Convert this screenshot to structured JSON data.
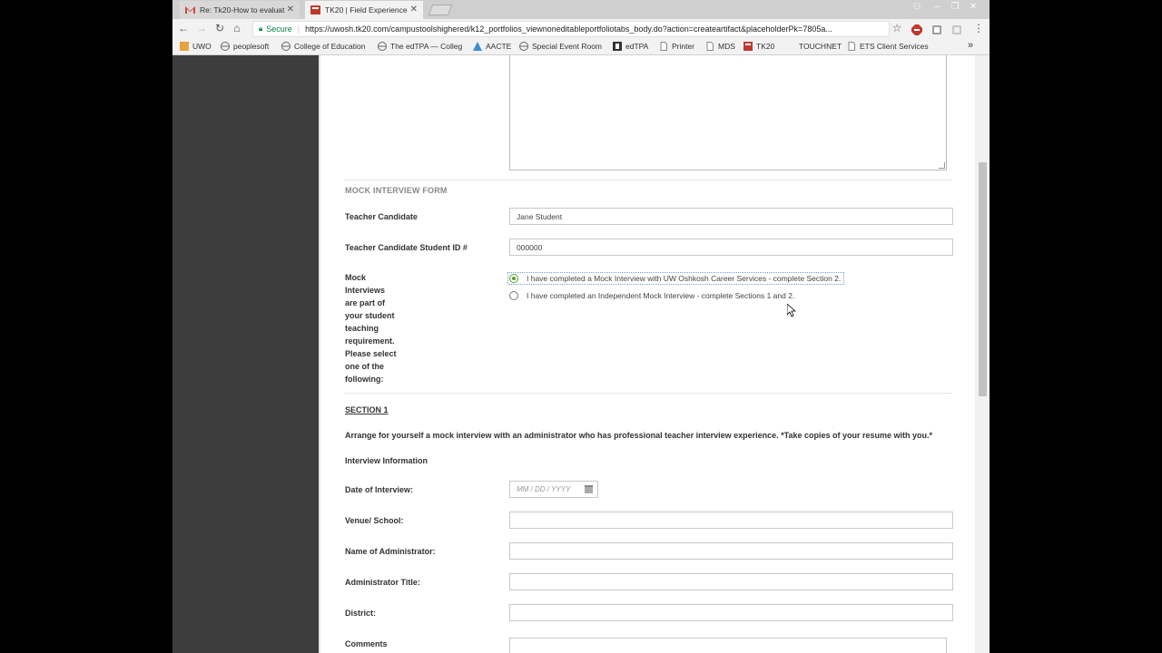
{
  "tabs": [
    {
      "title": "Re: Tk20-How to evaluat",
      "active": false,
      "icon": "gmail-icon"
    },
    {
      "title": "TK20 | Field Experience",
      "active": true,
      "icon": "tk20-icon"
    }
  ],
  "window_controls": {
    "user": "⚇",
    "minimize": "–",
    "maximize": "❐",
    "close": "✕"
  },
  "omnibox": {
    "secure_label": "Secure",
    "url": "https://uwosh.tk20.com/campustoolshighered/k12_portfolios_viewnoneditableportfoliotabs_body.do?action=createartifact&placeholderPk=7805a..."
  },
  "nav_glyphs": {
    "back": "←",
    "forward": "→",
    "reload": "↻",
    "home": "⌂",
    "star": "☆",
    "menu": "⋮",
    "more": "»"
  },
  "bookmarks": [
    {
      "label": "UWO",
      "icon": "bookmark-uwo-icon",
      "color": "#e8a33c"
    },
    {
      "label": "peoplesoft",
      "icon": "globe-icon",
      "color": "#666666"
    },
    {
      "label": "College of Education",
      "icon": "globe-icon",
      "color": "#666666"
    },
    {
      "label": "The edTPA — College",
      "icon": "globe-icon",
      "color": "#666666"
    },
    {
      "label": "AACTE",
      "icon": "aacte-icon",
      "color": "#3b8fd1"
    },
    {
      "label": "Special Event Room",
      "icon": "globe-icon",
      "color": "#666666"
    },
    {
      "label": "edTPA",
      "icon": "edtpa-icon",
      "color": "#333333"
    },
    {
      "label": "Printer",
      "icon": "page-icon",
      "color": "#888888"
    },
    {
      "label": "MDS",
      "icon": "page-icon",
      "color": "#888888"
    },
    {
      "label": "TK20",
      "icon": "tk20-icon",
      "color": "#c0392b"
    },
    {
      "label": "TOUCHNET",
      "icon": "blank-icon",
      "color": "#ffffff"
    },
    {
      "label": "ETS Client Services",
      "icon": "page-icon",
      "color": "#888888"
    }
  ],
  "form": {
    "section_title": "MOCK INTERVIEW FORM",
    "teacher_candidate_label": "Teacher Candidate",
    "teacher_candidate_value": "Jane Student",
    "student_id_label": "Teacher Candidate Student ID #",
    "student_id_value": "000000",
    "mock_question_lines": [
      "Mock",
      "Interviews",
      "are part of",
      "your student",
      "teaching",
      "requirement.",
      "Please select",
      "one of the",
      "following:"
    ],
    "options": [
      {
        "label": "I have completed a Mock Interview with UW Oshkosh Career Services - complete Section 2.",
        "checked": true
      },
      {
        "label": "I have completed an Independent Mock Interview - complete Sections 1 and 2.",
        "checked": false
      }
    ],
    "section1_title": "SECTION 1",
    "section1_instructions": "Arrange for yourself a mock interview with an administrator who has professional teacher interview experience. *Take copies of your resume with you.*",
    "interview_info_heading": "Interview Information",
    "date_label": "Date of Interview:",
    "date_placeholder": "MM / DD / YYYY",
    "venue_label": "Venue/ School:",
    "venue_value": "",
    "admin_name_label": "Name of Administrator:",
    "admin_name_value": "",
    "admin_title_label": "Administrator Title:",
    "admin_title_value": "",
    "district_label": "District:",
    "district_value": "",
    "comments_label": "Comments"
  },
  "colors": {
    "accent_green": "#5aa02c",
    "sidebar": "#3d3d3d",
    "secure_green": "#0b8043"
  }
}
